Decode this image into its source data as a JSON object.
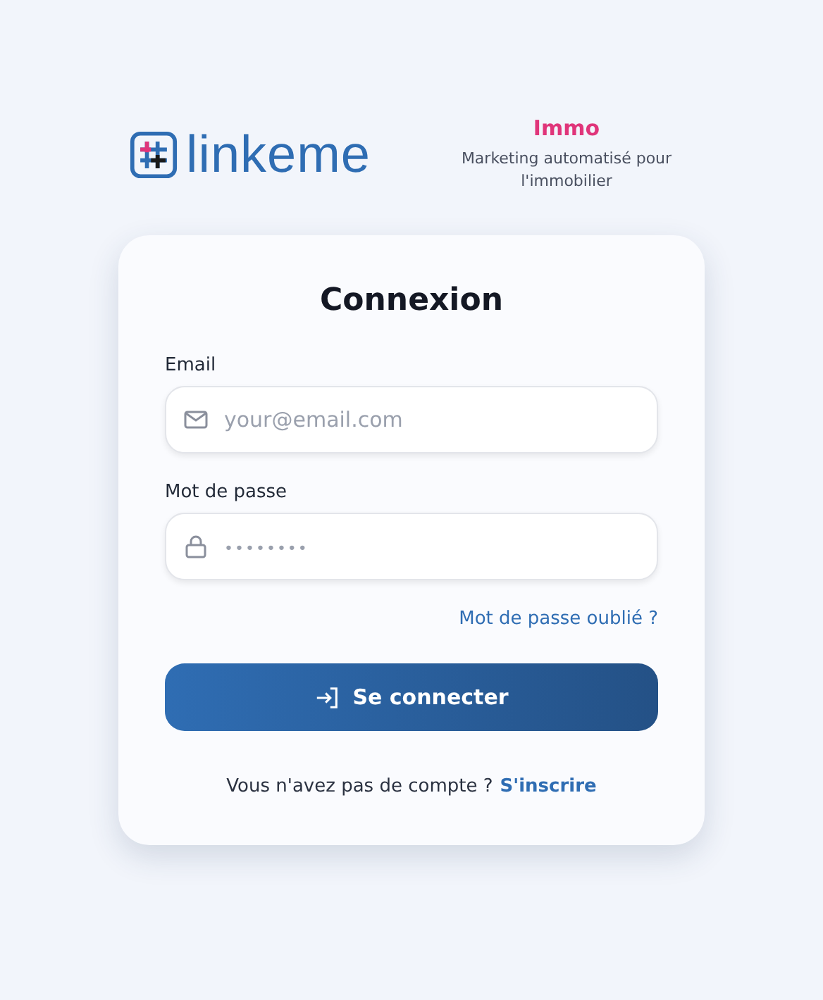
{
  "brand": {
    "name": "linkeme",
    "product": "Immo",
    "tagline": "Marketing automatisé pour l'immobilier"
  },
  "login": {
    "title": "Connexion",
    "fields": [
      {
        "kind": "email",
        "label": "Email",
        "placeholder": "your@email.com"
      },
      {
        "kind": "password",
        "label": "Mot de passe",
        "placeholder": "••••••••"
      }
    ],
    "forgot_link": "Mot de passe oublié ?",
    "submit": "Se connecter",
    "signup_prompt": "Vous n'avez pas de compte ?",
    "signup_link": "S'inscrire"
  }
}
